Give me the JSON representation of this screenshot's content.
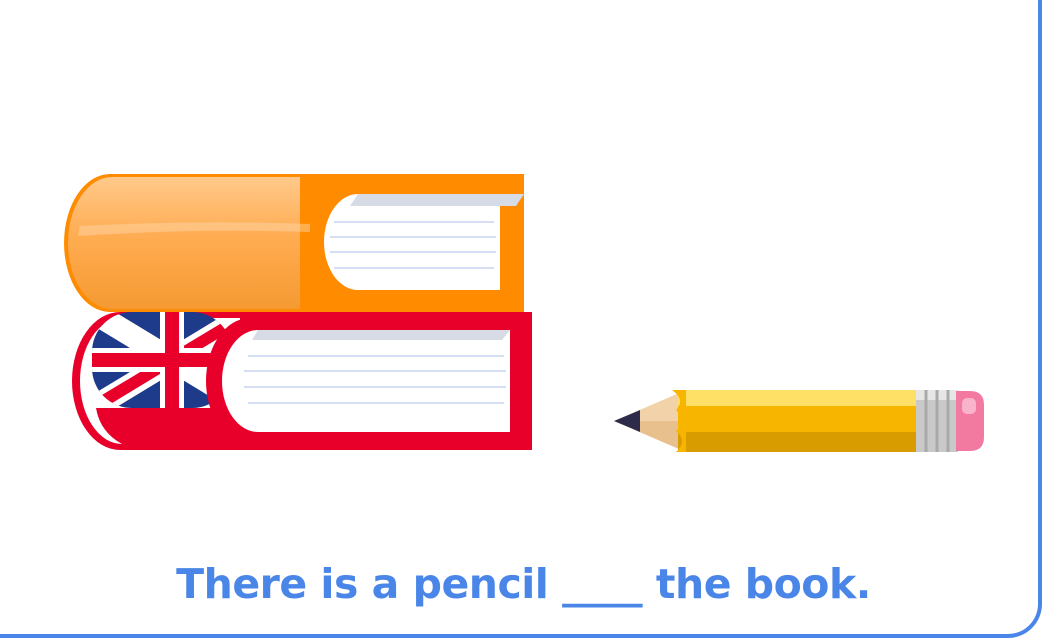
{
  "exercise": {
    "sentence": "There is a pencil ____ the book."
  },
  "illustration": {
    "objects": [
      "books-stack-icon",
      "pencil-icon"
    ],
    "colors": {
      "border": "#4a86e8",
      "text": "#4a86e8",
      "top_book": "#ff8c00",
      "bottom_book": "#e8002a",
      "pencil_body": "#f7b500",
      "eraser": "#f27aa0"
    }
  }
}
